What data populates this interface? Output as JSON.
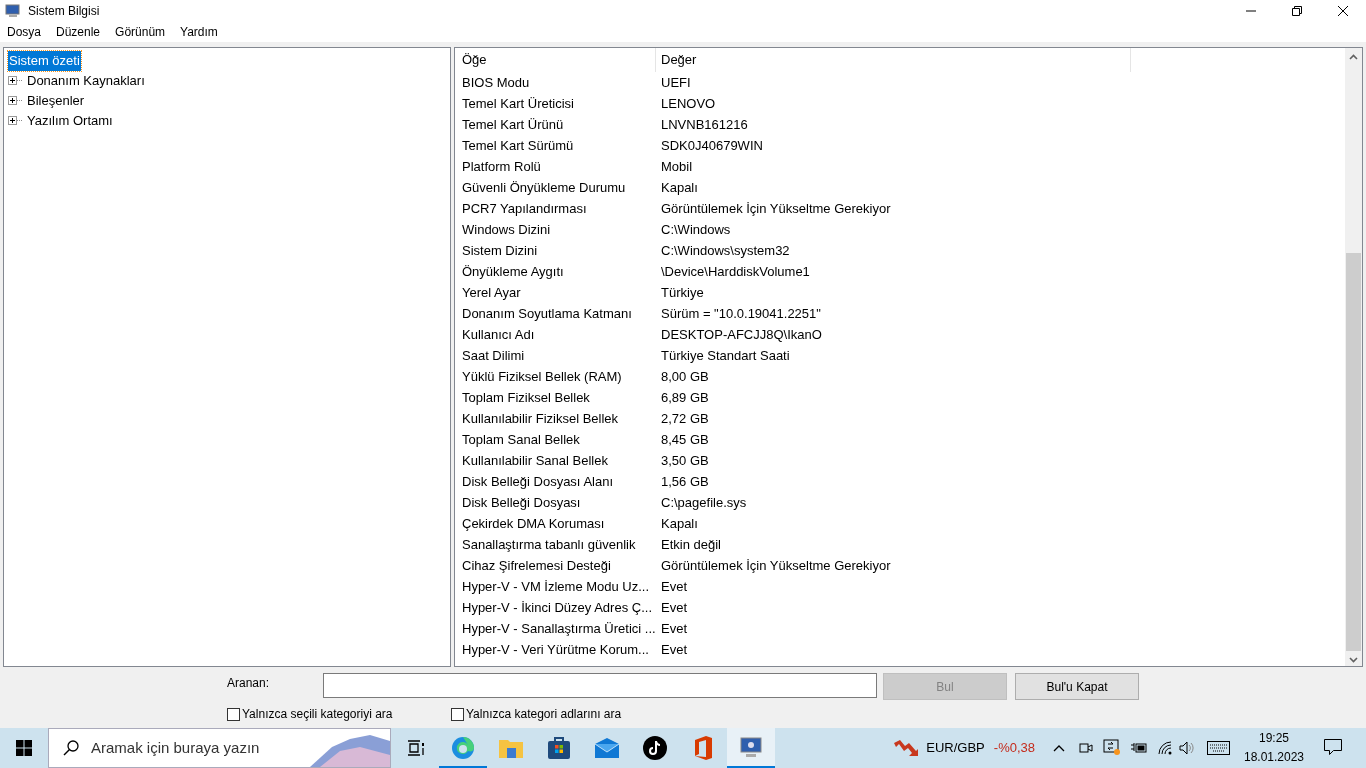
{
  "window": {
    "title": "Sistem Bilgisi"
  },
  "menu": [
    "Dosya",
    "Düzenle",
    "Görünüm",
    "Yardım"
  ],
  "tree": [
    {
      "label": "Sistem özeti",
      "selected": true,
      "expandable": false
    },
    {
      "label": "Donanım Kaynakları",
      "selected": false,
      "expandable": true
    },
    {
      "label": "Bileşenler",
      "selected": false,
      "expandable": true
    },
    {
      "label": "Yazılım Ortamı",
      "selected": false,
      "expandable": true
    }
  ],
  "table": {
    "columns": [
      "Öğe",
      "Değer"
    ],
    "rows": [
      [
        "BIOS Modu",
        "UEFI"
      ],
      [
        "Temel Kart Üreticisi",
        "LENOVO"
      ],
      [
        "Temel Kart Ürünü",
        "LNVNB161216"
      ],
      [
        "Temel Kart Sürümü",
        "SDK0J40679WIN"
      ],
      [
        "Platform Rolü",
        "Mobil"
      ],
      [
        "Güvenli Önyükleme Durumu",
        "Kapalı"
      ],
      [
        "PCR7 Yapılandırması",
        "Görüntülemek İçin Yükseltme Gerekiyor"
      ],
      [
        "Windows Dizini",
        "C:\\Windows"
      ],
      [
        "Sistem Dizini",
        "C:\\Windows\\system32"
      ],
      [
        "Önyükleme Aygıtı",
        "\\Device\\HarddiskVolume1"
      ],
      [
        "Yerel Ayar",
        "Türkiye"
      ],
      [
        "Donanım Soyutlama Katmanı",
        "Sürüm = \"10.0.19041.2251\""
      ],
      [
        "Kullanıcı Adı",
        "DESKTOP-AFCJJ8Q\\IkanO"
      ],
      [
        "Saat Dilimi",
        "Türkiye Standart Saati"
      ],
      [
        "Yüklü Fiziksel Bellek (RAM)",
        "8,00 GB"
      ],
      [
        "Toplam Fiziksel Bellek",
        "6,89 GB"
      ],
      [
        "Kullanılabilir Fiziksel Bellek",
        "2,72 GB"
      ],
      [
        "Toplam Sanal Bellek",
        "8,45 GB"
      ],
      [
        "Kullanılabilir Sanal Bellek",
        "3,50 GB"
      ],
      [
        "Disk Belleği Dosyası Alanı",
        "1,56 GB"
      ],
      [
        "Disk Belleği Dosyası",
        "C:\\pagefile.sys"
      ],
      [
        "Çekirdek DMA Koruması",
        "Kapalı"
      ],
      [
        "Sanallaştırma tabanlı güvenlik",
        "Etkin değil"
      ],
      [
        "Cihaz Şifrelemesi Desteği",
        "Görüntülemek İçin Yükseltme Gerekiyor"
      ],
      [
        "Hyper-V - VM İzleme Modu Uz...",
        "Evet"
      ],
      [
        "Hyper-V - İkinci Düzey Adres Ç...",
        "Evet"
      ],
      [
        "Hyper-V - Sanallaştırma Üretici ...",
        "Evet"
      ],
      [
        "Hyper-V - Veri Yürütme Korum...",
        "Evet"
      ]
    ]
  },
  "find": {
    "label": "Aranan:",
    "buttons": [
      {
        "label": "Bul",
        "disabled": true
      },
      {
        "label": "Bul'u Kapat",
        "disabled": false
      }
    ],
    "options": [
      {
        "label": "Yalnızca seçili kategoriyi ara",
        "checked": false
      },
      {
        "label": "Yalnızca kategori adlarını ara",
        "checked": false
      }
    ]
  },
  "taskbar": {
    "search": {
      "placeholder": "Aramak için buraya yazın"
    },
    "apps": [
      {
        "kind": "edge",
        "running": true,
        "selected": false
      },
      {
        "kind": "folder",
        "running": false,
        "selected": false
      },
      {
        "kind": "store",
        "running": false,
        "selected": false
      },
      {
        "kind": "mail",
        "running": false,
        "selected": false
      },
      {
        "kind": "tiktok",
        "running": false,
        "selected": false
      },
      {
        "kind": "office",
        "running": false,
        "selected": false
      },
      {
        "kind": "sysinfo",
        "running": true,
        "selected": true
      }
    ],
    "ticker": {
      "symbol": "EUR/GBP",
      "change": "-%0,38"
    },
    "time": "19:25",
    "date": "18.01.2023"
  }
}
